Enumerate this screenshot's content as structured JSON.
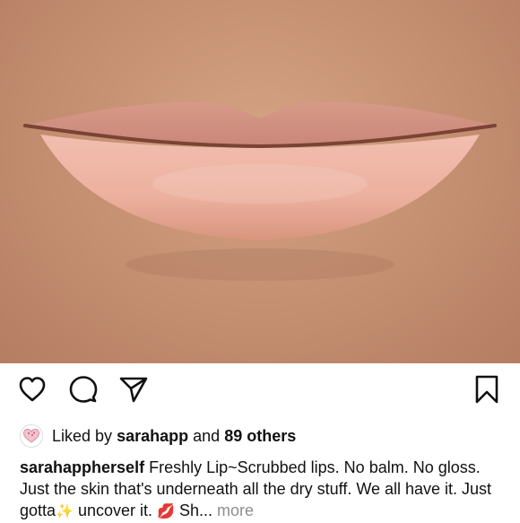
{
  "post": {
    "image_alt": "Close-up photo of lips",
    "actions": {
      "like_icon": "heart-outline-icon",
      "comment_icon": "comment-bubble-icon",
      "share_icon": "paper-plane-icon",
      "save_icon": "bookmark-outline-icon"
    },
    "likes": {
      "prefix": "Liked by",
      "user": "sarahapp",
      "and": "and",
      "others": "89 others"
    },
    "caption": {
      "username": "sarahappherself",
      "text_1": "Freshly Lip~Scrubbed lips. No balm. No gloss. Just the skin that's underneath all the dry stuff. We all have it. Just gotta",
      "sparkle_emoji": "✨",
      "text_2": "uncover it.",
      "kiss_emoji": "💋",
      "text_3": "Sh...",
      "more_label": "more"
    }
  }
}
